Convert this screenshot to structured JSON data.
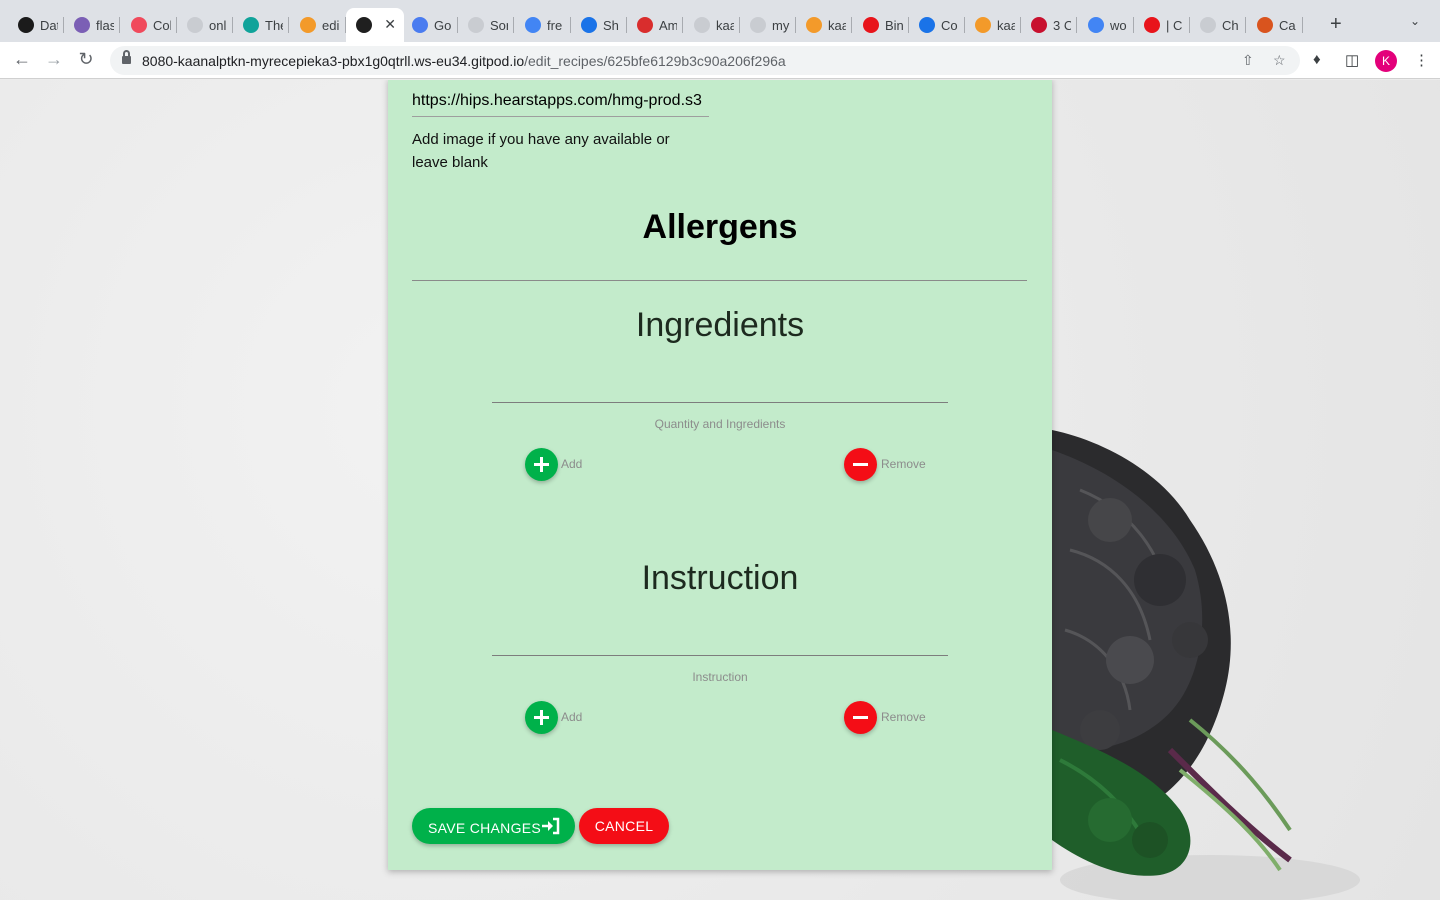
{
  "browser": {
    "tabs": [
      {
        "title": "Dat",
        "icon": "mongodb-leaf-icon",
        "color": "#1b1b1b"
      },
      {
        "title": "flas",
        "icon": "heroku-icon",
        "color": "#7b5fb5"
      },
      {
        "title": "Col",
        "icon": "monday-icon",
        "color": "#f04a5c"
      },
      {
        "title": "onl",
        "icon": "github-icon",
        "color": "#c9ccd1"
      },
      {
        "title": "The",
        "icon": "c-icon",
        "color": "#10a39a"
      },
      {
        "title": "edi",
        "icon": "gitpod-icon",
        "color": "#f39a2a"
      },
      {
        "title": "",
        "icon": "globe-icon",
        "color": "#1f1f1f",
        "active": true
      },
      {
        "title": "Go",
        "icon": "google-translate-icon",
        "color": "#4a7cf0"
      },
      {
        "title": "Sor",
        "icon": "github-icon",
        "color": "#c9ccd1"
      },
      {
        "title": "fre",
        "icon": "google-icon",
        "color": "#4285f4"
      },
      {
        "title": "Sh",
        "icon": "wave-icon",
        "color": "#1a73e8"
      },
      {
        "title": "Am",
        "icon": "bookmark-red-icon",
        "color": "#d92d2d"
      },
      {
        "title": "kaa",
        "icon": "github-icon",
        "color": "#c9ccd1"
      },
      {
        "title": "my",
        "icon": "github-icon",
        "color": "#c9ccd1"
      },
      {
        "title": "kaa",
        "icon": "gitpod-icon",
        "color": "#f39a2a"
      },
      {
        "title": "Bin",
        "icon": "opera-icon",
        "color": "#e8141b"
      },
      {
        "title": "Co",
        "icon": "c-circle-icon",
        "color": "#1a73e8"
      },
      {
        "title": "kaa",
        "icon": "gitpod-icon",
        "color": "#f39a2a"
      },
      {
        "title": "3 C",
        "icon": "car-icon",
        "color": "#c8102e"
      },
      {
        "title": "wo",
        "icon": "google-icon",
        "color": "#4285f4"
      },
      {
        "title": "| C",
        "icon": "opera-icon",
        "color": "#e8141b"
      },
      {
        "title": "Ch",
        "icon": "github-icon",
        "color": "#c9ccd1"
      },
      {
        "title": "Ca",
        "icon": "matlab-icon",
        "color": "#d9541e"
      }
    ],
    "url_host": "8080-kaanalptkn-myrecepieka3-pbx1g0qtrll.ws-eu34.gitpod.io",
    "url_path": "/edit_recipes/625bfe6129b3c90a206f296a",
    "profile_initial": "K"
  },
  "form": {
    "image_url_value": "https://hips.hearstapps.com/hmg-prod.s3",
    "image_helper": "Add image if you have any available or leave blank",
    "allergens_heading": "Allergens",
    "ingredients": {
      "heading": "Ingredients",
      "field_label": "Quantity and Ingredients",
      "add_label": "Add",
      "remove_label": "Remove"
    },
    "instruction": {
      "heading": "Instruction",
      "field_label": "Instruction",
      "add_label": "Add",
      "remove_label": "Remove"
    },
    "save_label": "SAVE CHANGES",
    "cancel_label": "CANCEL"
  },
  "colors": {
    "card_bg": "#c3ebcb",
    "add_green": "#00b14a",
    "remove_red": "#f40d16"
  }
}
